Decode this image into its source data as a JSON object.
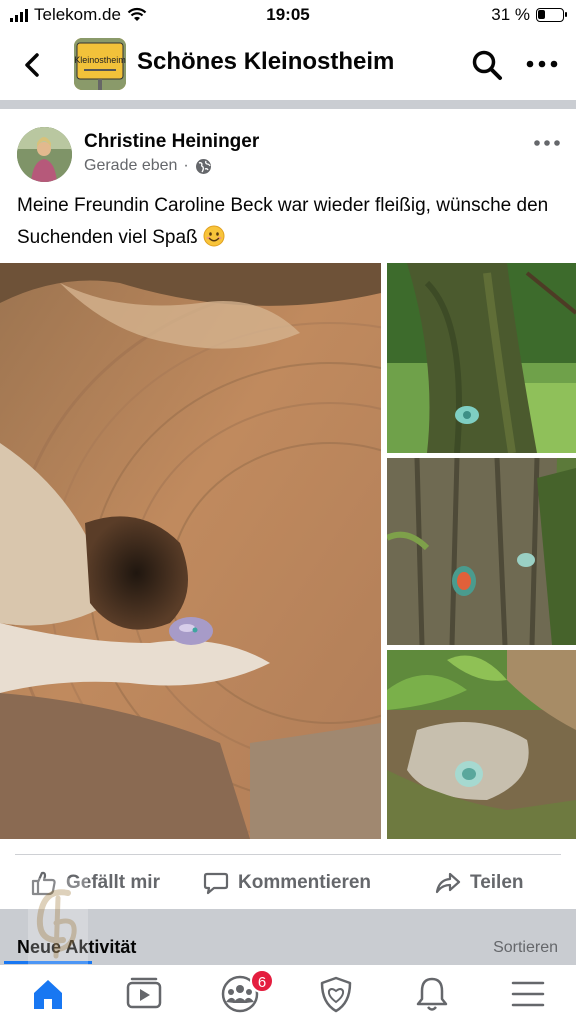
{
  "status_bar": {
    "carrier": "Telekom.de",
    "time": "19:05",
    "battery_percent": "31 %",
    "battery_level": 0.31
  },
  "header": {
    "group_name": "Schönes Kleinostheim",
    "thumb_text": "Kleinostheim"
  },
  "post": {
    "author": "Christine Heininger",
    "time": "Gerade eben",
    "audience_icon": "globe-icon",
    "text": "Meine Freundin Caroline Beck war wieder fleißig, wünsche den Suchenden viel Spaß",
    "emoji": "smiling-face-emoji",
    "photo_count": 4
  },
  "actions": {
    "like": "Gefällt mir",
    "comment": "Kommentieren",
    "share": "Teilen"
  },
  "activity": {
    "label": "Neue Aktivität",
    "sort": "Sortieren"
  },
  "tabbar": {
    "items": [
      "home-icon",
      "video-icon",
      "groups-icon",
      "shield-icon",
      "bell-icon",
      "menu-icon"
    ],
    "groups_badge": "6",
    "active": "home-icon",
    "accent": "#1877f2",
    "badge_color": "#e41e3f"
  }
}
